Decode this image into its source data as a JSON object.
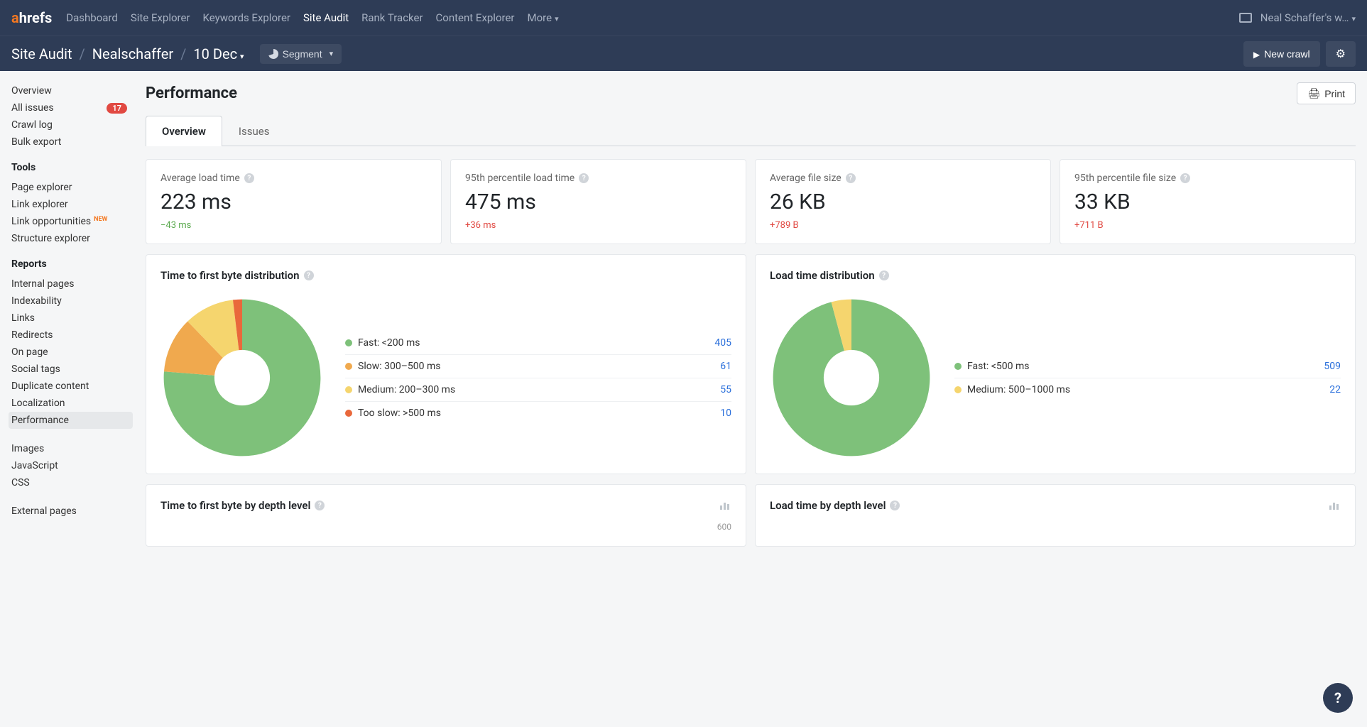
{
  "topnav": {
    "logo_a": "a",
    "logo_rest": "hrefs",
    "links": [
      "Dashboard",
      "Site Explorer",
      "Keywords Explorer",
      "Site Audit",
      "Rank Tracker",
      "Content Explorer",
      "More"
    ],
    "active_index": 3,
    "workspace": "Neal Schaffer's w…"
  },
  "subnav": {
    "crumb1": "Site Audit",
    "crumb2": "Nealschaffer",
    "crumb3": "10 Dec",
    "segment_label": "Segment",
    "new_crawl": "New crawl"
  },
  "sidebar": {
    "top": [
      {
        "label": "Overview"
      },
      {
        "label": "All issues",
        "badge": "17"
      },
      {
        "label": "Crawl log"
      },
      {
        "label": "Bulk export"
      }
    ],
    "tools_heading": "Tools",
    "tools": [
      {
        "label": "Page explorer"
      },
      {
        "label": "Link explorer"
      },
      {
        "label": "Link opportunities",
        "new": "NEW"
      },
      {
        "label": "Structure explorer"
      }
    ],
    "reports_heading": "Reports",
    "reports": [
      {
        "label": "Internal pages"
      },
      {
        "label": "Indexability"
      },
      {
        "label": "Links"
      },
      {
        "label": "Redirects"
      },
      {
        "label": "On page"
      },
      {
        "label": "Social tags"
      },
      {
        "label": "Duplicate content"
      },
      {
        "label": "Localization"
      },
      {
        "label": "Performance",
        "active": true
      }
    ],
    "bottom": [
      {
        "label": "Images"
      },
      {
        "label": "JavaScript"
      },
      {
        "label": "CSS"
      }
    ],
    "external": [
      {
        "label": "External pages"
      }
    ]
  },
  "main": {
    "title": "Performance",
    "print": "Print",
    "tabs": [
      "Overview",
      "Issues"
    ],
    "metrics": [
      {
        "label": "Average load time",
        "value": "223 ms",
        "delta": "−43 ms",
        "delta_class": "green"
      },
      {
        "label": "95th percentile load time",
        "value": "475 ms",
        "delta": "+36 ms",
        "delta_class": "red"
      },
      {
        "label": "Average file size",
        "value": "26 KB",
        "delta": "+789 B",
        "delta_class": "red"
      },
      {
        "label": "95th percentile file size",
        "value": "33 KB",
        "delta": "+711 B",
        "delta_class": "red"
      }
    ],
    "chart1": {
      "title": "Time to first byte distribution"
    },
    "chart2": {
      "title": "Load time distribution"
    },
    "depth1": {
      "title": "Time to first byte by depth level",
      "axis": "600"
    },
    "depth2": {
      "title": "Load time by depth level"
    }
  },
  "chart_data": [
    {
      "type": "pie",
      "title": "Time to first byte distribution",
      "series": [
        {
          "name": "Fast: <200 ms",
          "value": 405,
          "color": "#7ec17a"
        },
        {
          "name": "Slow: 300–500 ms",
          "value": 61,
          "color": "#f0a94e"
        },
        {
          "name": "Medium: 200–300 ms",
          "value": 55,
          "color": "#f5d56e"
        },
        {
          "name": "Too slow: >500 ms",
          "value": 10,
          "color": "#e9683b"
        }
      ]
    },
    {
      "type": "pie",
      "title": "Load time distribution",
      "series": [
        {
          "name": "Fast: <500 ms",
          "value": 509,
          "color": "#7ec17a"
        },
        {
          "name": "Medium: 500–1000 ms",
          "value": 22,
          "color": "#f5d56e"
        }
      ]
    }
  ]
}
